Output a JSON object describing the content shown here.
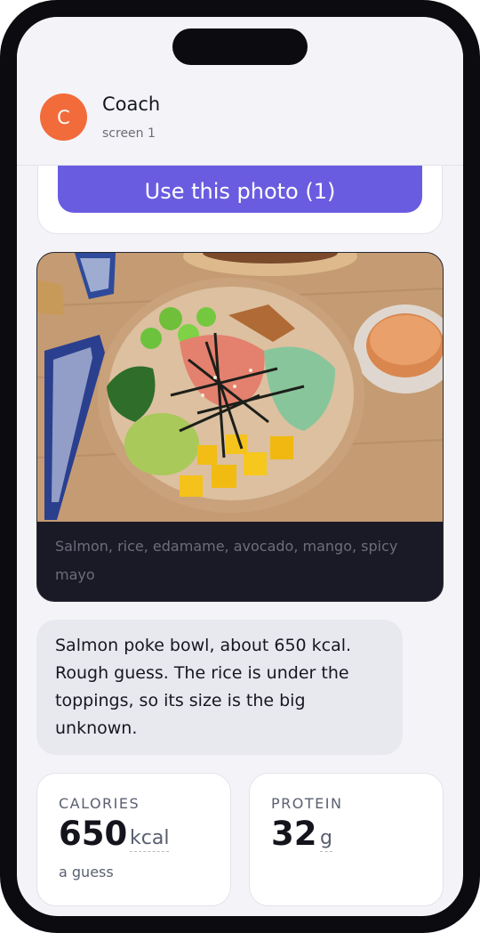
{
  "header": {
    "avatar_letter": "C",
    "name": "Coach",
    "subtitle": "screen 1"
  },
  "photo_panel": {
    "use_button_label": "Use this photo (1)",
    "caption": "Salmon, rice, edamame, avocado, mango, spicy mayo"
  },
  "message": {
    "text": "Salmon poke bowl, about 650 kcal. Rough guess. The rice is under the toppings, so its size is the big unknown."
  },
  "stats": {
    "calories": {
      "label": "CALORIES",
      "value": "650",
      "unit": "kcal",
      "note": "a guess"
    },
    "protein": {
      "label": "PROTEIN",
      "value": "32",
      "unit": "g"
    }
  },
  "colors": {
    "accent": "#6a5ce0",
    "avatar": "#f26b3a",
    "caption_panel": "#1a1a26"
  }
}
